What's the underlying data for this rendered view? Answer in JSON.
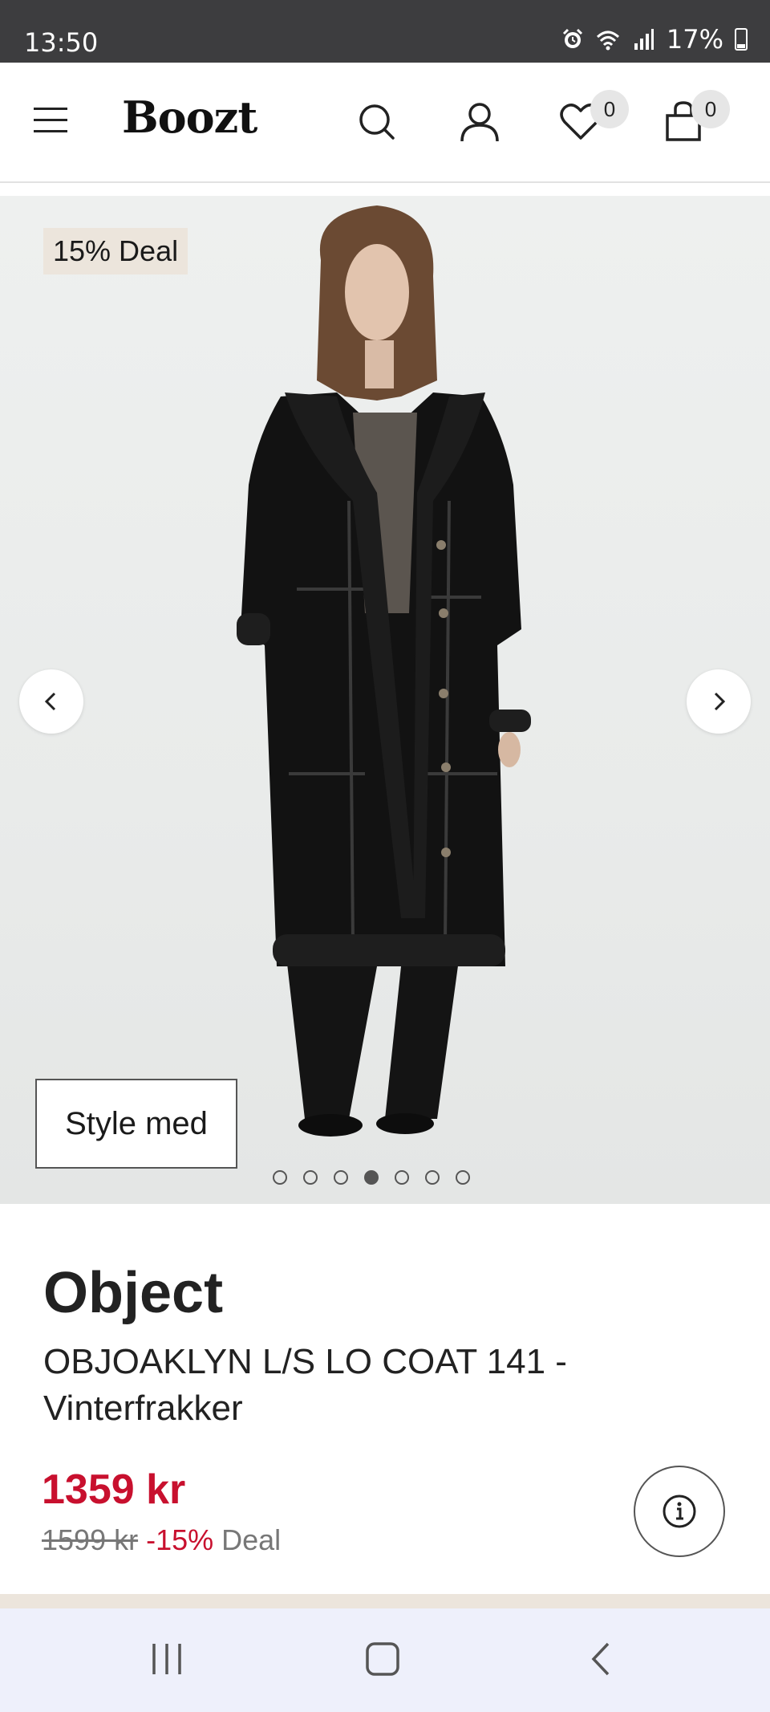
{
  "status_bar": {
    "time": "13:50",
    "battery": "17%",
    "icons": [
      "alarm-icon",
      "wifi-icon",
      "signal-icon",
      "battery-icon"
    ]
  },
  "header": {
    "logo": "Boozt",
    "wishlist_count": "0",
    "cart_count": "0",
    "icons": [
      "menu-icon",
      "search-icon",
      "user-icon",
      "heart-icon",
      "bag-icon"
    ]
  },
  "gallery": {
    "deal_badge": "15% Deal",
    "style_button": "Style med",
    "image_count": 7,
    "active_index": 3
  },
  "product": {
    "brand": "Object",
    "name": "OBJOAKLYN L/S LO COAT 141 - Vinterfrakker",
    "price": "1359 kr",
    "original_price": "1599 kr",
    "discount": "-15%",
    "deal_label": "Deal"
  },
  "colors": {
    "price_red": "#c8102e",
    "beige": "#ece5dc",
    "status_bar": "#3d3d3f",
    "nav_bar": "#eef0fb"
  }
}
